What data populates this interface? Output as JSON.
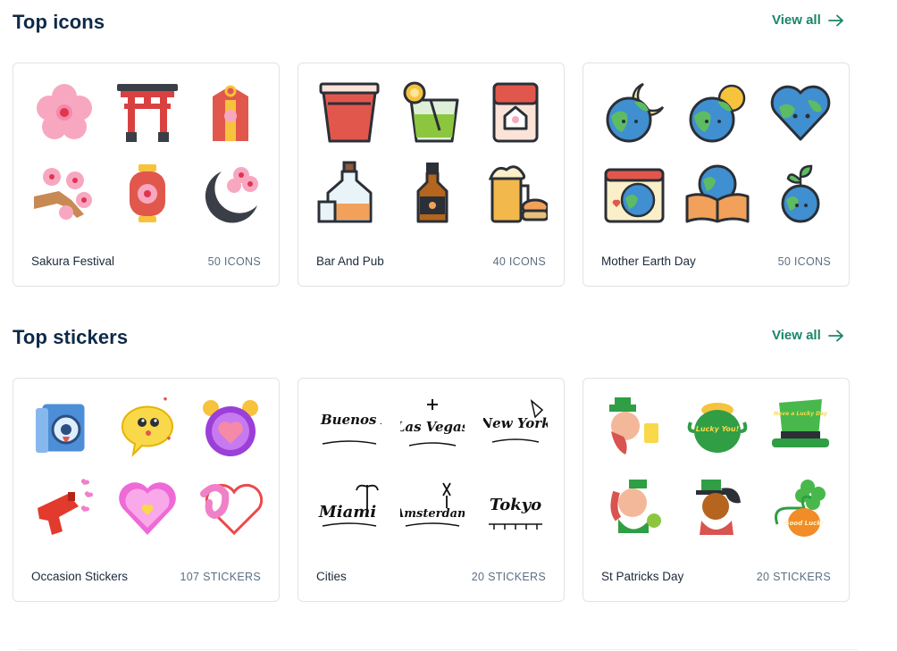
{
  "sections": [
    {
      "title": "Top icons",
      "view_all": "View all",
      "cards": [
        {
          "name": "Sakura Festival",
          "count": "50 ICONS",
          "thumbs": [
            "cherry-blossom-icon",
            "torii-gate-icon",
            "omamori-charm-icon",
            "blossom-branch-icon",
            "paper-lantern-icon",
            "crescent-moon-blossom-icon"
          ]
        },
        {
          "name": "Bar And Pub",
          "count": "40 ICONS",
          "thumbs": [
            "cup-icon",
            "cocktail-glass-icon",
            "matchbox-icon",
            "whiskey-decanter-icon",
            "liquor-bottle-icon",
            "beer-mug-burger-icon"
          ]
        },
        {
          "name": "Mother Earth Day",
          "count": "50 ICONS",
          "thumbs": [
            "earth-moon-icon",
            "earth-sun-icon",
            "heart-earth-icon",
            "earth-calendar-icon",
            "earth-book-icon",
            "earth-sprout-icon"
          ]
        }
      ]
    },
    {
      "title": "Top stickers",
      "view_all": "View all",
      "cards": [
        {
          "name": "Occasion Stickers",
          "count": "107 STICKERS",
          "thumbs": [
            "washing-machine-sticker",
            "speech-bubble-face-sticker",
            "alarm-clock-heart-sticker",
            "party-gun-sticker",
            "pink-heart-sticker",
            "heart-stroke-sticker"
          ]
        },
        {
          "name": "Cities",
          "count": "20 STICKERS",
          "thumbs": [
            "buenos-aires-lettering",
            "las-vegas-lettering",
            "new-york-lettering",
            "miami-lettering",
            "amsterdam-lettering",
            "tokyo-lettering"
          ],
          "lettering": [
            "Buenos Aires",
            "Las Vegas",
            "New York",
            "Miami",
            "Amsterdam",
            "Tokyo"
          ]
        },
        {
          "name": "St Patricks Day",
          "count": "20 STICKERS",
          "thumbs": [
            "leprechaun-beer-sticker",
            "pot-of-gold-sticker",
            "leprechaun-hat-sticker",
            "leprechaun-girl-sticker",
            "leprechaun-man-sticker",
            "good-luck-clover-sticker"
          ],
          "lettering": [
            "Lucky You!",
            "Have a Lucky Day",
            "Good Luck!"
          ]
        }
      ]
    }
  ],
  "colors": {
    "title": "#0e2a47",
    "accent": "#1a8569",
    "count": "#5c6f82",
    "border": "#dfe3e8"
  }
}
